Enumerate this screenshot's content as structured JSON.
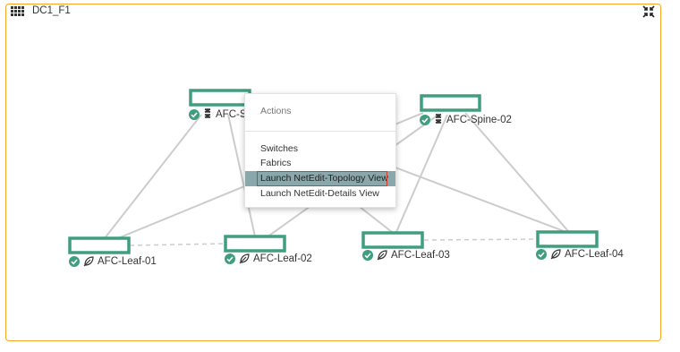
{
  "panel": {
    "title": "DC1_F1",
    "icons": {
      "grid": "grid-icon",
      "collapse": "collapse-icon"
    },
    "border_color": "#f5a623"
  },
  "colors": {
    "node": "#3f9e7d",
    "status_ok": "#3f9e7d",
    "link": "#cccccc",
    "menu_active": "#8aa8ab",
    "highlight": "#d04030"
  },
  "nodes": {
    "spine01": {
      "label": "AFC-Sp",
      "role": "spine-icon",
      "status": "check-circle-icon"
    },
    "spine02": {
      "label": "AFC-Spine-02",
      "role": "spine-icon",
      "status": "check-circle-icon"
    },
    "leaf01": {
      "label": "AFC-Leaf-01",
      "role": "leaf-icon",
      "status": "check-circle-icon"
    },
    "leaf02": {
      "label": "AFC-Leaf-02",
      "role": "leaf-icon",
      "status": "check-circle-icon"
    },
    "leaf03": {
      "label": "AFC-Leaf-03",
      "role": "leaf-icon",
      "status": "check-circle-icon"
    },
    "leaf04": {
      "label": "AFC-Leaf-04",
      "role": "leaf-icon",
      "status": "check-circle-icon"
    }
  },
  "context_menu": {
    "header": "Actions",
    "items": [
      {
        "label": "Switches"
      },
      {
        "label": "Fabrics"
      },
      {
        "label": "Launch NetEdit-Topology View"
      },
      {
        "label": "Launch NetEdit-Details View"
      }
    ],
    "active_index": 2
  }
}
